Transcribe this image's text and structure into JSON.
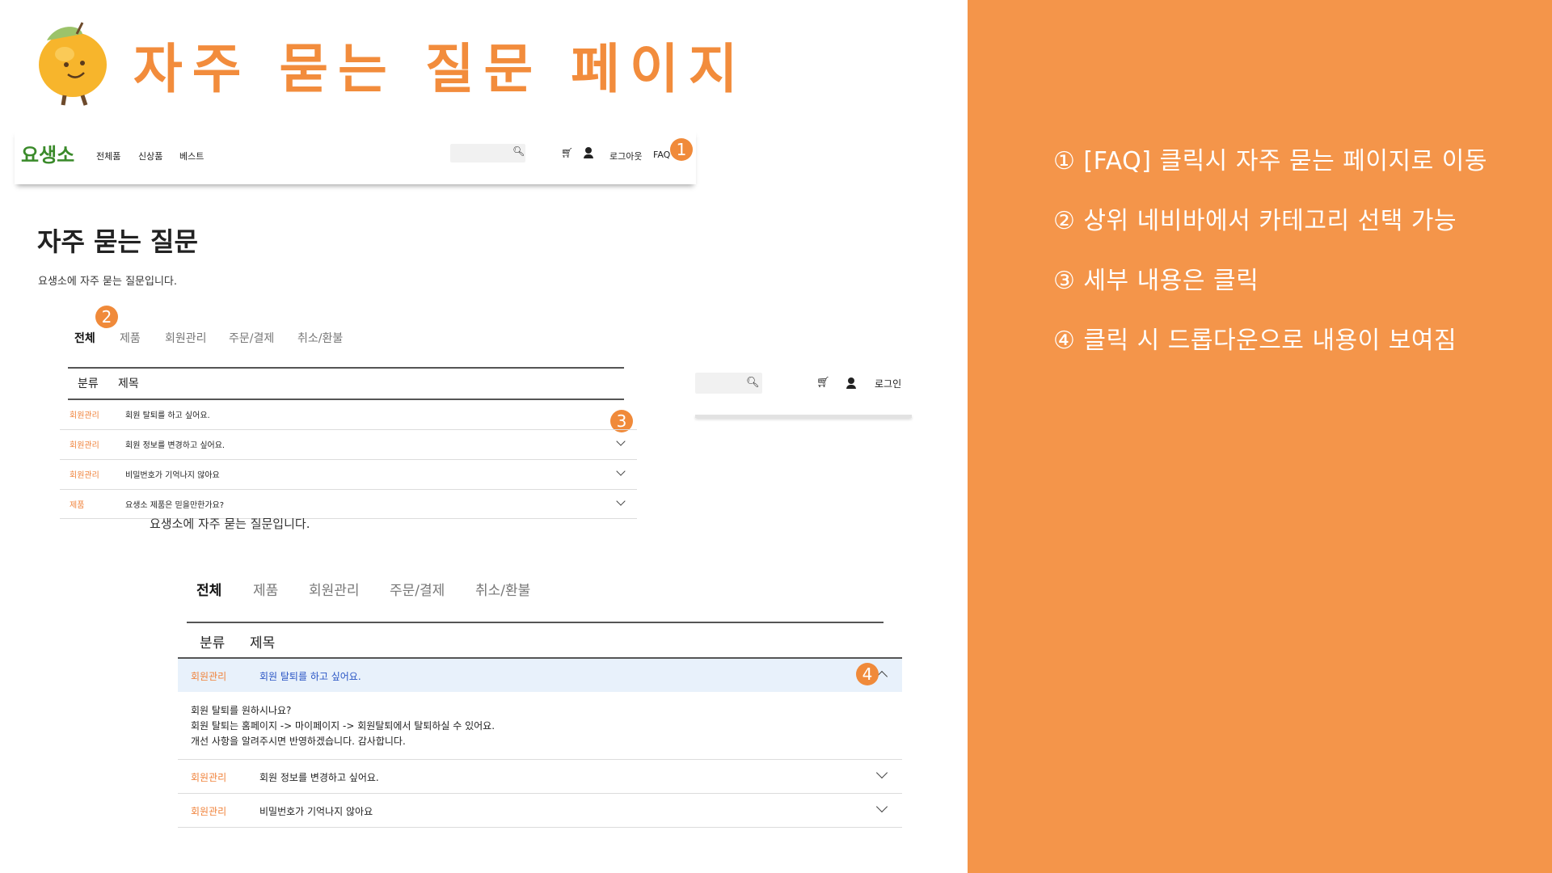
{
  "slide": {
    "title": "자주 묻는 질문 페이지",
    "notes": [
      "① [FAQ] 클릭시 자주 묻는 페이지로 이동",
      "② 상위 네비바에서 카테고리 선택 가능",
      "③ 세부 내용은 클릭",
      "④ 클릭 시 드롭다운으로 내용이 보여짐"
    ],
    "badges": [
      "1",
      "2",
      "3",
      "4"
    ],
    "colors": {
      "accent": "#f4954a",
      "title": "#f28c3c",
      "category": "#f0823a",
      "expanded_bg": "#e8f1fb",
      "expanded_text": "#2a55c4"
    }
  },
  "site": {
    "logo": "요생소",
    "nav": [
      "전체품",
      "신상품",
      "베스트"
    ],
    "search_placeholder": "",
    "header_links": [
      "로그아웃",
      "FAQ"
    ],
    "login": "로그인"
  },
  "faq": {
    "heading": "자주 묻는 질문",
    "subheading": "요생소에 자주 묻는 질문입니다.",
    "tabs": [
      "전체",
      "제품",
      "회원관리",
      "주문/결제",
      "취소/환불"
    ],
    "columns": [
      "분류",
      "제목"
    ],
    "rows": [
      {
        "category": "회원관리",
        "title": "회원 탈퇴를 하고 싶어요."
      },
      {
        "category": "회원관리",
        "title": "회원 정보를 변경하고 싶어요."
      },
      {
        "category": "회원관리",
        "title": "비밀번호가 기억나지 않아요"
      },
      {
        "category": "제품",
        "title": "요생소 제품은 믿을만한가요?"
      }
    ],
    "answer": [
      "회원 탈퇴를 원하시나요?",
      "회원 탈퇴는 홈페이지 -> 마이페이지 -> 회원탈퇴에서 탈퇴하실 수 있어요.",
      "개선 사항을 알려주시면 반영하겠습니다. 감사합니다."
    ]
  }
}
